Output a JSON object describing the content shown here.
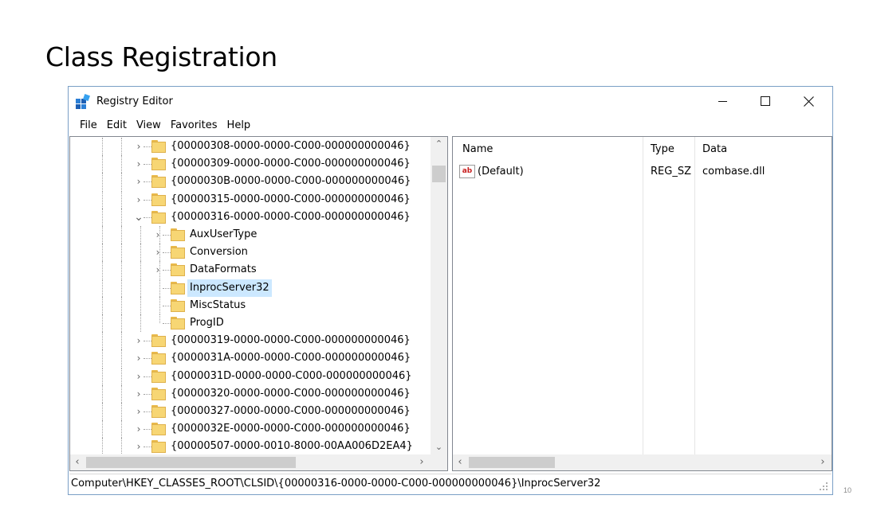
{
  "slide": {
    "title": "Class Registration",
    "page_number": "10"
  },
  "window": {
    "title": "Registry Editor",
    "icon": "registry-editor-icon",
    "controls": [
      "minimize-icon",
      "maximize-icon",
      "close-icon"
    ]
  },
  "menu": [
    "File",
    "Edit",
    "View",
    "Favorites",
    "Help"
  ],
  "tree": {
    "items": [
      {
        "label": "{00000308-0000-0000-C000-000000000046}",
        "depth": 0,
        "expander": "collapsed"
      },
      {
        "label": "{00000309-0000-0000-C000-000000000046}",
        "depth": 0,
        "expander": "collapsed"
      },
      {
        "label": "{0000030B-0000-0000-C000-000000000046}",
        "depth": 0,
        "expander": "collapsed"
      },
      {
        "label": "{00000315-0000-0000-C000-000000000046}",
        "depth": 0,
        "expander": "collapsed"
      },
      {
        "label": "{00000316-0000-0000-C000-000000000046}",
        "depth": 0,
        "expander": "expanded"
      },
      {
        "label": "AuxUserType",
        "depth": 1,
        "expander": "collapsed"
      },
      {
        "label": "Conversion",
        "depth": 1,
        "expander": "collapsed"
      },
      {
        "label": "DataFormats",
        "depth": 1,
        "expander": "collapsed"
      },
      {
        "label": "InprocServer32",
        "depth": 1,
        "expander": "none",
        "selected": true
      },
      {
        "label": "MiscStatus",
        "depth": 1,
        "expander": "none"
      },
      {
        "label": "ProgID",
        "depth": 1,
        "expander": "none"
      },
      {
        "label": "{00000319-0000-0000-C000-000000000046}",
        "depth": 0,
        "expander": "collapsed"
      },
      {
        "label": "{0000031A-0000-0000-C000-000000000046}",
        "depth": 0,
        "expander": "collapsed"
      },
      {
        "label": "{0000031D-0000-0000-C000-000000000046}",
        "depth": 0,
        "expander": "collapsed"
      },
      {
        "label": "{00000320-0000-0000-C000-000000000046}",
        "depth": 0,
        "expander": "collapsed"
      },
      {
        "label": "{00000327-0000-0000-C000-000000000046}",
        "depth": 0,
        "expander": "collapsed"
      },
      {
        "label": "{0000032E-0000-0000-C000-000000000046}",
        "depth": 0,
        "expander": "collapsed"
      },
      {
        "label": "{00000507-0000-0010-8000-00AA006D2EA4}",
        "depth": 0,
        "expander": "collapsed"
      }
    ]
  },
  "values": {
    "headers": {
      "name": "Name",
      "type": "Type",
      "data": "Data"
    },
    "rows": [
      {
        "icon_text": "ab",
        "name": "(Default)",
        "type": "REG_SZ",
        "data": "combase.dll"
      }
    ]
  },
  "status": {
    "path": "Computer\\HKEY_CLASSES_ROOT\\CLSID\\{00000316-0000-0000-C000-000000000046}\\InprocServer32"
  },
  "colors": {
    "selection": "#cce8ff",
    "folder": "#f7d674",
    "window_border": "#7a9fc6"
  }
}
